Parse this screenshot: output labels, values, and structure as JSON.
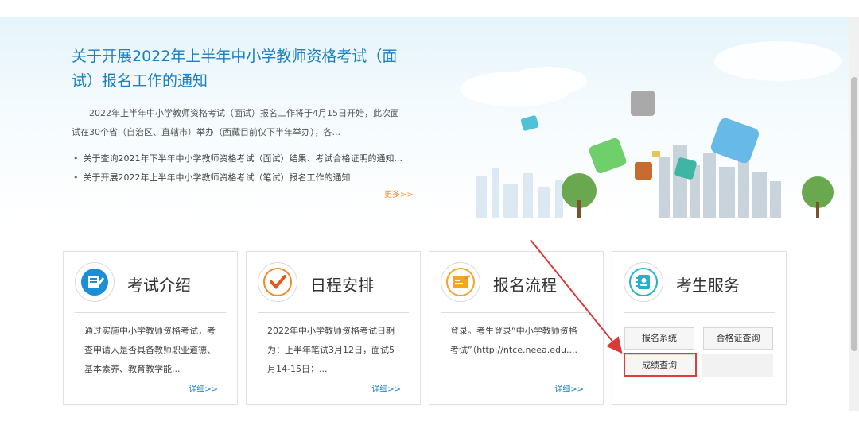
{
  "banner": {
    "title": "关于开展2022年上半年中小学教师资格考试（面试）报名工作的通知",
    "summary": "2022年上半年中小学教师资格考试（面试）报名工作将于4月15日开始，此次面试在30个省（自治区、直辖市）举办（西藏目前仅下半年举办），各...",
    "news": [
      "关于查询2021年下半年中小学教师资格考试（面试）结果、考试合格证明的通知...",
      "关于开展2022年上半年中小学教师资格考试（笔试）报名工作的通知"
    ],
    "more_label": "更多>>"
  },
  "cards": [
    {
      "title": "考试介绍",
      "icon": "exam-intro-icon",
      "desc": "通过实施中小学教师资格考试，考查申请人是否具备教师职业道德、基本素养、教育教学能...",
      "detail": "详细>>"
    },
    {
      "title": "日程安排",
      "icon": "checkmark-icon",
      "desc": "2022年中小学教师资格考试日期为：上半年笔试3月12日，面试5月14-15日；...",
      "detail": "详细>>"
    },
    {
      "title": "报名流程",
      "icon": "registration-icon",
      "desc": "登录。考生登录“中小学教师资格考试”（http://ntce.neea.edu....",
      "detail": "详细>>"
    },
    {
      "title": "考生服务",
      "icon": "contacts-book-icon"
    }
  ],
  "services": {
    "register": "报名系统",
    "certificate": "合格证查询",
    "score": "成绩查询"
  },
  "colors": {
    "accent": "#1a7fc3",
    "more": "#f08a24",
    "highlight": "#e03c3c"
  }
}
